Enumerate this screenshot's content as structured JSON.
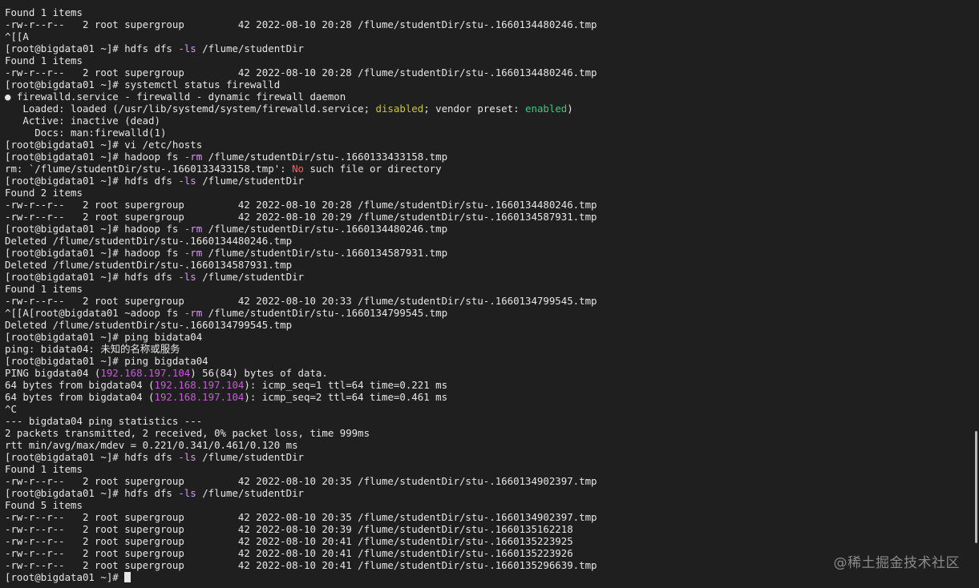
{
  "terminal": {
    "lines": [
      [
        {
          "t": "Found 1 items"
        }
      ],
      [
        {
          "t": "-rw-r--r--   2 root supergroup         42 2022-08-10 20:28 /flume/studentDir/stu-.1660134480246.tmp"
        }
      ],
      [
        {
          "t": "^[[A"
        }
      ],
      [
        {
          "t": "[root@bigdata01 ~]# hdfs dfs "
        },
        {
          "t": "-ls",
          "c": "flag"
        },
        {
          "t": " /flume/studentDir"
        }
      ],
      [
        {
          "t": "Found 1 items"
        }
      ],
      [
        {
          "t": "-rw-r--r--   2 root supergroup         42 2022-08-10 20:28 /flume/studentDir/stu-.1660134480246.tmp"
        }
      ],
      [
        {
          "t": "[root@bigdata01 ~]# systemctl status firewalld"
        }
      ],
      [
        {
          "t": "● firewalld.service - firewalld - dynamic firewall daemon"
        }
      ],
      [
        {
          "t": "   Loaded: loaded (/usr/lib/systemd/system/firewalld.service; "
        },
        {
          "t": "disabled",
          "c": "yellow"
        },
        {
          "t": "; vendor preset: "
        },
        {
          "t": "enabled",
          "c": "green"
        },
        {
          "t": ")"
        }
      ],
      [
        {
          "t": "   Active: inactive (dead)"
        }
      ],
      [
        {
          "t": "     Docs: man:firewalld(1)"
        }
      ],
      [
        {
          "t": "[root@bigdata01 ~]# vi /etc/hosts"
        }
      ],
      [
        {
          "t": "[root@bigdata01 ~]# hadoop fs "
        },
        {
          "t": "-rm",
          "c": "flag"
        },
        {
          "t": " /flume/studentDir/stu-.1660133433158.tmp"
        }
      ],
      [
        {
          "t": "rm: `/flume/studentDir/stu-.1660133433158.tmp': "
        },
        {
          "t": "No",
          "c": "err"
        },
        {
          "t": " such file or directory"
        }
      ],
      [
        {
          "t": "[root@bigdata01 ~]# hdfs dfs "
        },
        {
          "t": "-ls",
          "c": "flag"
        },
        {
          "t": " /flume/studentDir"
        }
      ],
      [
        {
          "t": "Found 2 items"
        }
      ],
      [
        {
          "t": "-rw-r--r--   2 root supergroup         42 2022-08-10 20:28 /flume/studentDir/stu-.1660134480246.tmp"
        }
      ],
      [
        {
          "t": "-rw-r--r--   2 root supergroup         42 2022-08-10 20:29 /flume/studentDir/stu-.1660134587931.tmp"
        }
      ],
      [
        {
          "t": "[root@bigdata01 ~]# hadoop fs "
        },
        {
          "t": "-rm",
          "c": "flag"
        },
        {
          "t": " /flume/studentDir/stu-.1660134480246.tmp"
        }
      ],
      [
        {
          "t": "Deleted /flume/studentDir/stu-.1660134480246.tmp"
        }
      ],
      [
        {
          "t": "[root@bigdata01 ~]# hadoop fs "
        },
        {
          "t": "-rm",
          "c": "flag"
        },
        {
          "t": " /flume/studentDir/stu-.1660134587931.tmp"
        }
      ],
      [
        {
          "t": "Deleted /flume/studentDir/stu-.1660134587931.tmp"
        }
      ],
      [
        {
          "t": "[root@bigdata01 ~]# hdfs dfs "
        },
        {
          "t": "-ls",
          "c": "flag"
        },
        {
          "t": " /flume/studentDir"
        }
      ],
      [
        {
          "t": "Found 1 items"
        }
      ],
      [
        {
          "t": "-rw-r--r--   2 root supergroup         42 2022-08-10 20:33 /flume/studentDir/stu-.1660134799545.tmp"
        }
      ],
      [
        {
          "t": "^[[A[root@bigdata01 ~adoop fs "
        },
        {
          "t": "-rm",
          "c": "flag"
        },
        {
          "t": " /flume/studentDir/stu-.1660134799545.tmp"
        }
      ],
      [
        {
          "t": "Deleted /flume/studentDir/stu-.1660134799545.tmp"
        }
      ],
      [
        {
          "t": "[root@bigdata01 ~]# ping bidata04"
        }
      ],
      [
        {
          "t": "ping: bidata04: 未知的名称或服务"
        }
      ],
      [
        {
          "t": "[root@bigdata01 ~]# ping bigdata04"
        }
      ],
      [
        {
          "t": "PING bigdata04 ("
        },
        {
          "t": "192.168.197.104",
          "c": "ip"
        },
        {
          "t": ") 56(84) bytes of data."
        }
      ],
      [
        {
          "t": "64 bytes from bigdata04 ("
        },
        {
          "t": "192.168.197.104",
          "c": "ip"
        },
        {
          "t": "): icmp_seq=1 ttl=64 time=0.221 ms"
        }
      ],
      [
        {
          "t": "64 bytes from bigdata04 ("
        },
        {
          "t": "192.168.197.104",
          "c": "ip"
        },
        {
          "t": "): icmp_seq=2 ttl=64 time=0.461 ms"
        }
      ],
      [
        {
          "t": "^C"
        }
      ],
      [
        {
          "t": "--- bigdata04 ping statistics ---"
        }
      ],
      [
        {
          "t": "2 packets transmitted, 2 received, 0% packet loss, time 999ms"
        }
      ],
      [
        {
          "t": "rtt min/avg/max/mdev = 0.221/0.341/0.461/0.120 ms"
        }
      ],
      [
        {
          "t": "[root@bigdata01 ~]# hdfs dfs "
        },
        {
          "t": "-ls",
          "c": "flag"
        },
        {
          "t": " /flume/studentDir"
        }
      ],
      [
        {
          "t": "Found 1 items"
        }
      ],
      [
        {
          "t": "-rw-r--r--   2 root supergroup         42 2022-08-10 20:35 /flume/studentDir/stu-.1660134902397.tmp"
        }
      ],
      [
        {
          "t": "[root@bigdata01 ~]# hdfs dfs "
        },
        {
          "t": "-ls",
          "c": "flag"
        },
        {
          "t": " /flume/studentDir"
        }
      ],
      [
        {
          "t": "Found 5 items"
        }
      ],
      [
        {
          "t": "-rw-r--r--   2 root supergroup         42 2022-08-10 20:35 /flume/studentDir/stu-.1660134902397.tmp"
        }
      ],
      [
        {
          "t": "-rw-r--r--   2 root supergroup         42 2022-08-10 20:39 /flume/studentDir/stu-.1660135162218"
        }
      ],
      [
        {
          "t": "-rw-r--r--   2 root supergroup         42 2022-08-10 20:41 /flume/studentDir/stu-.1660135223925"
        }
      ],
      [
        {
          "t": "-rw-r--r--   2 root supergroup         42 2022-08-10 20:41 /flume/studentDir/stu-.1660135223926"
        }
      ],
      [
        {
          "t": "-rw-r--r--   2 root supergroup         42 2022-08-10 20:41 /flume/studentDir/stu-.1660135296639.tmp"
        }
      ]
    ],
    "prompt": "[root@bigdata01 ~]# "
  },
  "scrollbar": {
    "position": 0.905
  },
  "watermark": {
    "text": "@稀土掘金技术社区"
  },
  "colors": {
    "background": "#1f1f1f",
    "text": "#e6e6e6",
    "flag": "#d59cf5",
    "ip": "#c75dd5",
    "error": "#ff5f5f",
    "disabled": "#c8c83a",
    "enabled": "#3ac880"
  }
}
